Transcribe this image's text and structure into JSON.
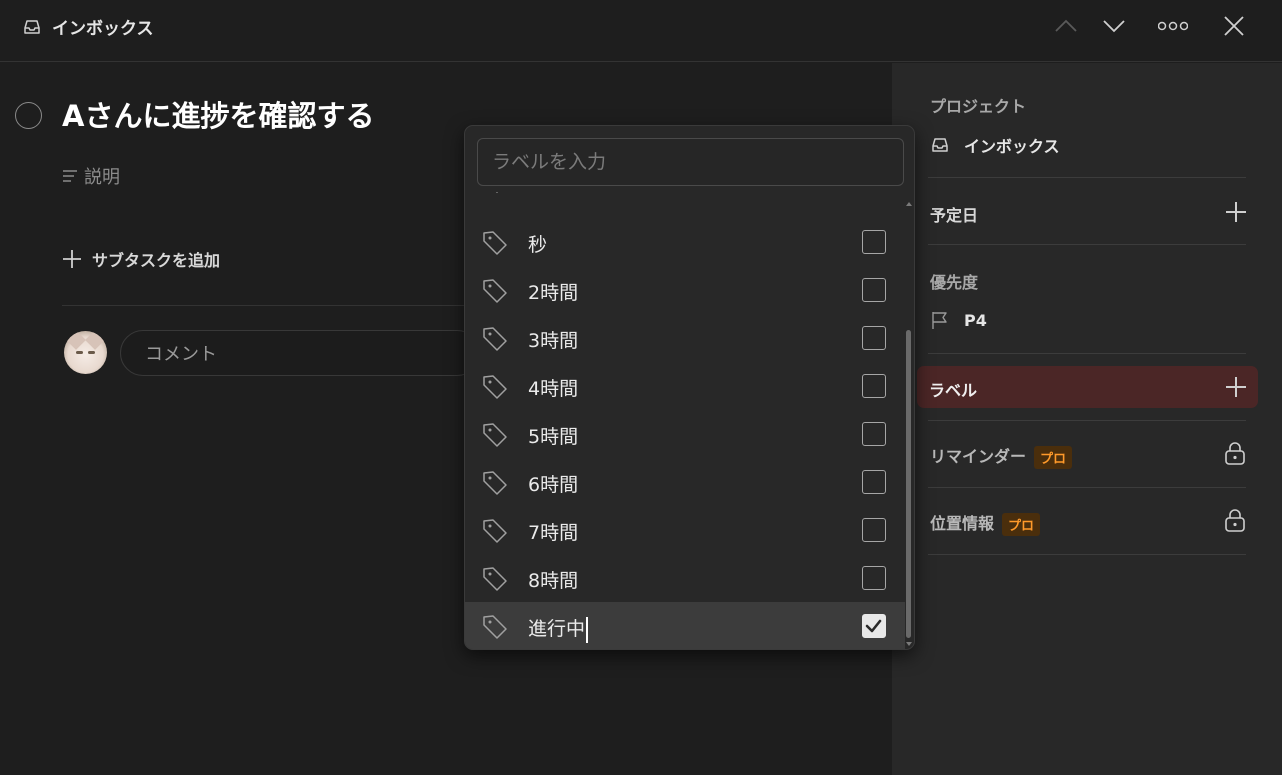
{
  "header": {
    "project_name": "インボックス",
    "icons": [
      "inbox-icon",
      "chevron-up-icon",
      "chevron-down-icon",
      "more-icon",
      "close-icon"
    ]
  },
  "task": {
    "title": "Aさんに進捗を確認する",
    "description_placeholder": "説明",
    "add_subtask_label": "サブタスクを追加",
    "comment_placeholder": "コメント"
  },
  "sidebar": {
    "project_label": "プロジェクト",
    "project_value": "インボックス",
    "due_label": "予定日",
    "priority_label": "優先度",
    "priority_value": "P4",
    "labels_label": "ラベル",
    "reminder_label": "リマインダー",
    "location_label": "位置情報",
    "pro_badge": "プロ"
  },
  "label_dropdown": {
    "placeholder": "ラベルを入力",
    "items": [
      {
        "name": "",
        "checked": false
      },
      {
        "name": "秒",
        "checked": false
      },
      {
        "name": "2時間",
        "checked": false
      },
      {
        "name": "3時間",
        "checked": false
      },
      {
        "name": "4時間",
        "checked": false
      },
      {
        "name": "5時間",
        "checked": false
      },
      {
        "name": "6時間",
        "checked": false
      },
      {
        "name": "7時間",
        "checked": false
      },
      {
        "name": "8時間",
        "checked": false
      },
      {
        "name": "進行中",
        "checked": true
      }
    ]
  },
  "colors": {
    "background": "#1e1e1e",
    "sidebar": "#282828",
    "label_highlight": "#4b2626",
    "pro_text": "#ff9a2a"
  }
}
